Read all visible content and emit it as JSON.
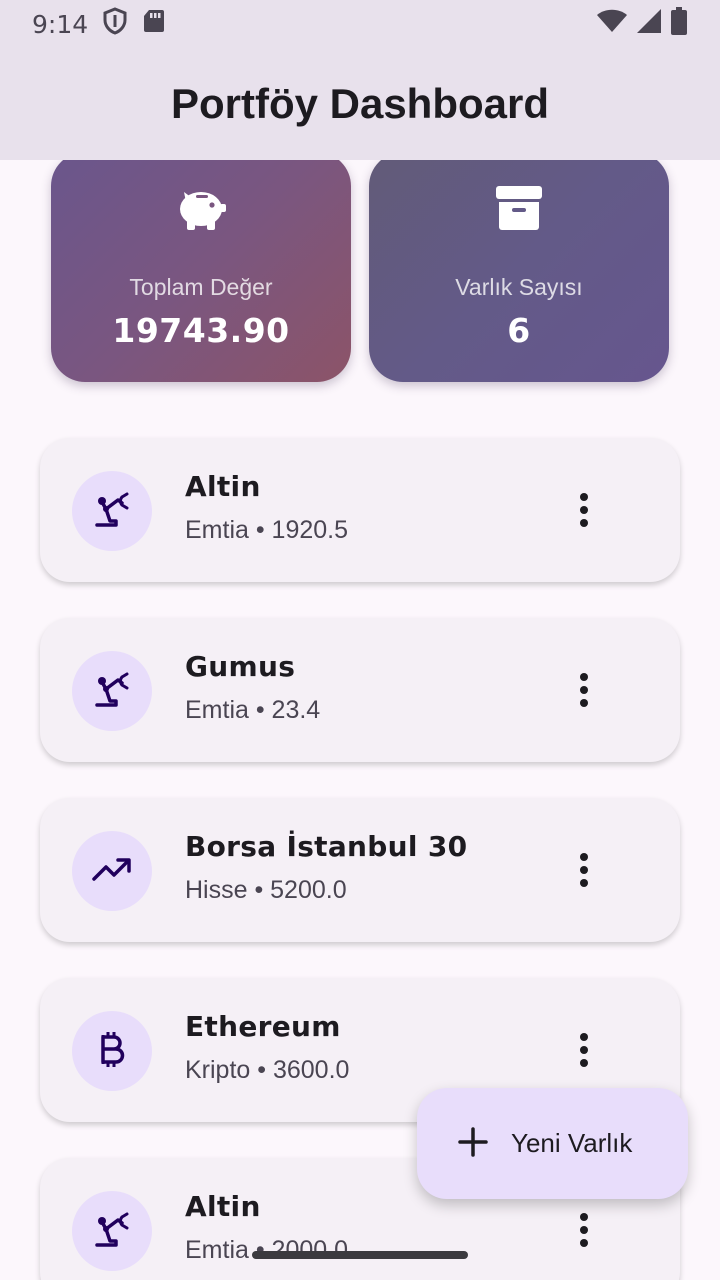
{
  "status_bar": {
    "time": "9:14"
  },
  "app_bar": {
    "title": "Portföy Dashboard"
  },
  "summary": {
    "total": {
      "label": "Toplam Değer",
      "value": "19743.90",
      "icon": "piggy-bank-icon"
    },
    "count": {
      "label": "Varlık Sayısı",
      "value": "6",
      "icon": "archive-icon"
    }
  },
  "assets": [
    {
      "name": "Altin",
      "subtitle": "Emtia • 1920.5",
      "icon": "precision-manufacturing-icon"
    },
    {
      "name": "Gumus",
      "subtitle": "Emtia • 23.4",
      "icon": "precision-manufacturing-icon"
    },
    {
      "name": "Borsa İstanbul 30",
      "subtitle": "Hisse • 5200.0",
      "icon": "trending-up-icon"
    },
    {
      "name": "Ethereum",
      "subtitle": "Kripto • 3600.0",
      "icon": "bitcoin-icon"
    },
    {
      "name": "Altin",
      "subtitle": "Emtia • 2000.0",
      "icon": "precision-manufacturing-icon"
    }
  ],
  "fab": {
    "label": "Yeni Varlık",
    "icon": "plus-icon"
  },
  "colors": {
    "app_bar_bg": "#e8e1ec",
    "avatar_bg": "#e8ddfb",
    "icon_color": "#21005d",
    "card_bg": "#f5f0f6"
  }
}
